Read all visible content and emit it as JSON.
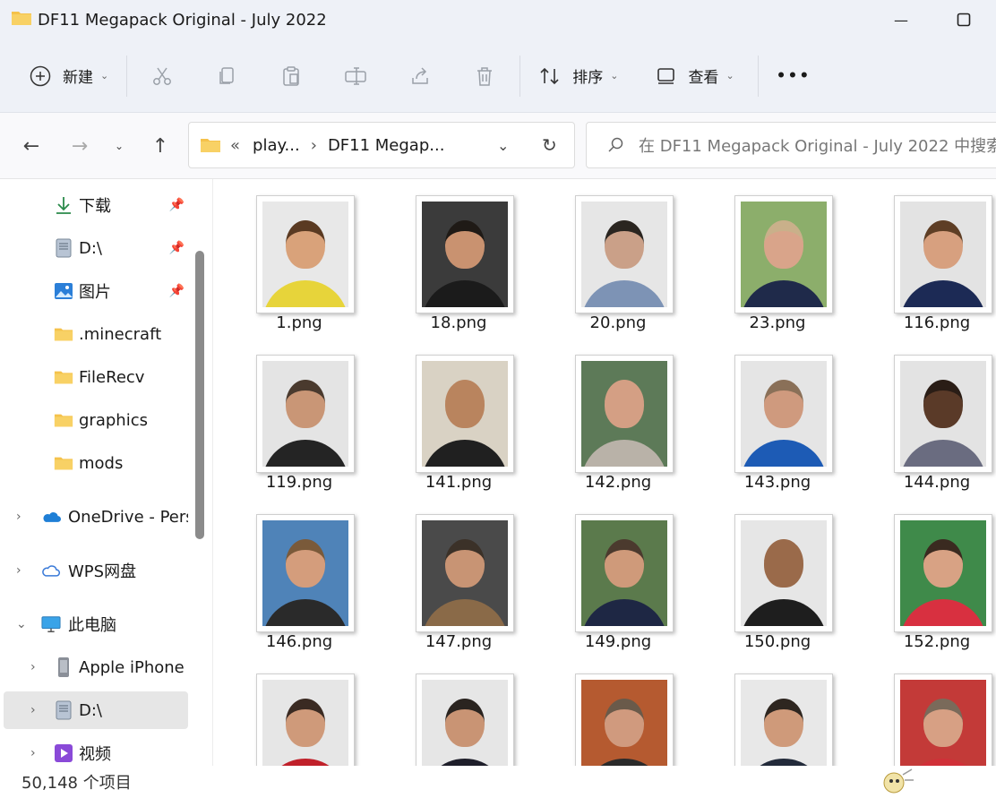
{
  "window": {
    "title": "DF11 Megapack Original - July 2022"
  },
  "toolbar": {
    "new_label": "新建",
    "sort_label": "排序",
    "view_label": "查看",
    "more_label": "•••"
  },
  "address": {
    "overflow": "«",
    "segments": [
      "play...",
      "DF11 Megap..."
    ],
    "search_placeholder": "在 DF11 Megapack Original - July 2022 中搜索"
  },
  "sidebar": {
    "items": [
      {
        "label": "下载",
        "icon": "download-icon",
        "pinned": true
      },
      {
        "label": "D:\\",
        "icon": "drive-icon",
        "pinned": true
      },
      {
        "label": "图片",
        "icon": "pictures-icon",
        "pinned": true
      },
      {
        "label": ".minecraft",
        "icon": "folder-icon"
      },
      {
        "label": "FileRecv",
        "icon": "folder-icon"
      },
      {
        "label": "graphics",
        "icon": "folder-icon"
      },
      {
        "label": "mods",
        "icon": "folder-icon"
      },
      {
        "label": "OneDrive - Pers",
        "icon": "onedrive-icon"
      },
      {
        "label": "WPS网盘",
        "icon": "cloud-icon"
      },
      {
        "label": "此电脑",
        "icon": "pc-icon"
      },
      {
        "label": "Apple iPhone",
        "icon": "phone-icon"
      },
      {
        "label": "D:\\",
        "icon": "drive-icon"
      },
      {
        "label": "视频",
        "icon": "video-icon"
      }
    ]
  },
  "files": [
    {
      "name": "1.png",
      "bg": "#e8e8e8",
      "skin": "#d9a27a",
      "hair": "#5a3a22",
      "shirt": "#e7d43a"
    },
    {
      "name": "18.png",
      "bg": "#3b3b3b",
      "skin": "#c99270",
      "hair": "#1f1a16",
      "shirt": "#1b1b1b"
    },
    {
      "name": "20.png",
      "bg": "#e6e6e6",
      "skin": "#caa088",
      "hair": "#2a2520",
      "shirt": "#7d93b5"
    },
    {
      "name": "23.png",
      "bg": "#8cae6b",
      "skin": "#d9a48a",
      "hair": "#c9b08a",
      "shirt": "#1f2a4a"
    },
    {
      "name": "116.png",
      "bg": "#e3e3e3",
      "skin": "#d7a07f",
      "hair": "#5e3e25",
      "shirt": "#1c2a55"
    },
    {
      "name": "119.png",
      "bg": "#e4e4e4",
      "skin": "#c99676",
      "hair": "#4a3a2e",
      "shirt": "#242424"
    },
    {
      "name": "141.png",
      "bg": "#d9d2c4",
      "skin": "#b9845e",
      "hair": "#b9845e",
      "shirt": "#202020"
    },
    {
      "name": "142.png",
      "bg": "#5d7a58",
      "skin": "#d49f84",
      "hair": "#d49f84",
      "shirt": "#b9b2a8"
    },
    {
      "name": "143.png",
      "bg": "#e5e5e5",
      "skin": "#cf9a7e",
      "hair": "#8a7058",
      "shirt": "#1d5bb5"
    },
    {
      "name": "144.png",
      "bg": "#e3e3e3",
      "skin": "#5a3a28",
      "hair": "#2a1d16",
      "shirt": "#6a6c80"
    },
    {
      "name": "146.png",
      "bg": "#4f83b8",
      "skin": "#d49d7c",
      "hair": "#7a5a3a",
      "shirt": "#2a2a2a"
    },
    {
      "name": "147.png",
      "bg": "#4a4a4a",
      "skin": "#c89474",
      "hair": "#3b3128",
      "shirt": "#8a6a48"
    },
    {
      "name": "149.png",
      "bg": "#5b7a4c",
      "skin": "#cf9a7a",
      "hair": "#4b3a2e",
      "shirt": "#1e2744"
    },
    {
      "name": "150.png",
      "bg": "#e6e6e6",
      "skin": "#9a6a4a",
      "hair": "#9a6a4a",
      "shirt": "#1e1e1e"
    },
    {
      "name": "152.png",
      "bg": "#3f8a4a",
      "skin": "#d8a284",
      "hair": "#3a2a20",
      "shirt": "#d83040"
    },
    {
      "name": "",
      "bg": "#e6e6e6",
      "skin": "#cf9a7a",
      "hair": "#3a2a22",
      "shirt": "#c0202a"
    },
    {
      "name": "",
      "bg": "#e6e6e6",
      "skin": "#c99474",
      "hair": "#2a2420",
      "shirt": "#1e1e2a"
    },
    {
      "name": "",
      "bg": "#b55a30",
      "skin": "#d09a7e",
      "hair": "#6a5a4a",
      "shirt": "#2a2a2a"
    },
    {
      "name": "",
      "bg": "#e8e8e8",
      "skin": "#cf9a7a",
      "hair": "#2e2620",
      "shirt": "#222a3a"
    },
    {
      "name": "",
      "bg": "#c33a38",
      "skin": "#d7a084",
      "hair": "#7a6a5a",
      "shirt": "#d03038"
    }
  ],
  "status": {
    "count": "50,148 个项目"
  },
  "colors": {
    "accent": "#0067c0",
    "folder": "#f5c24b",
    "titlebar": "#eef1f7"
  }
}
